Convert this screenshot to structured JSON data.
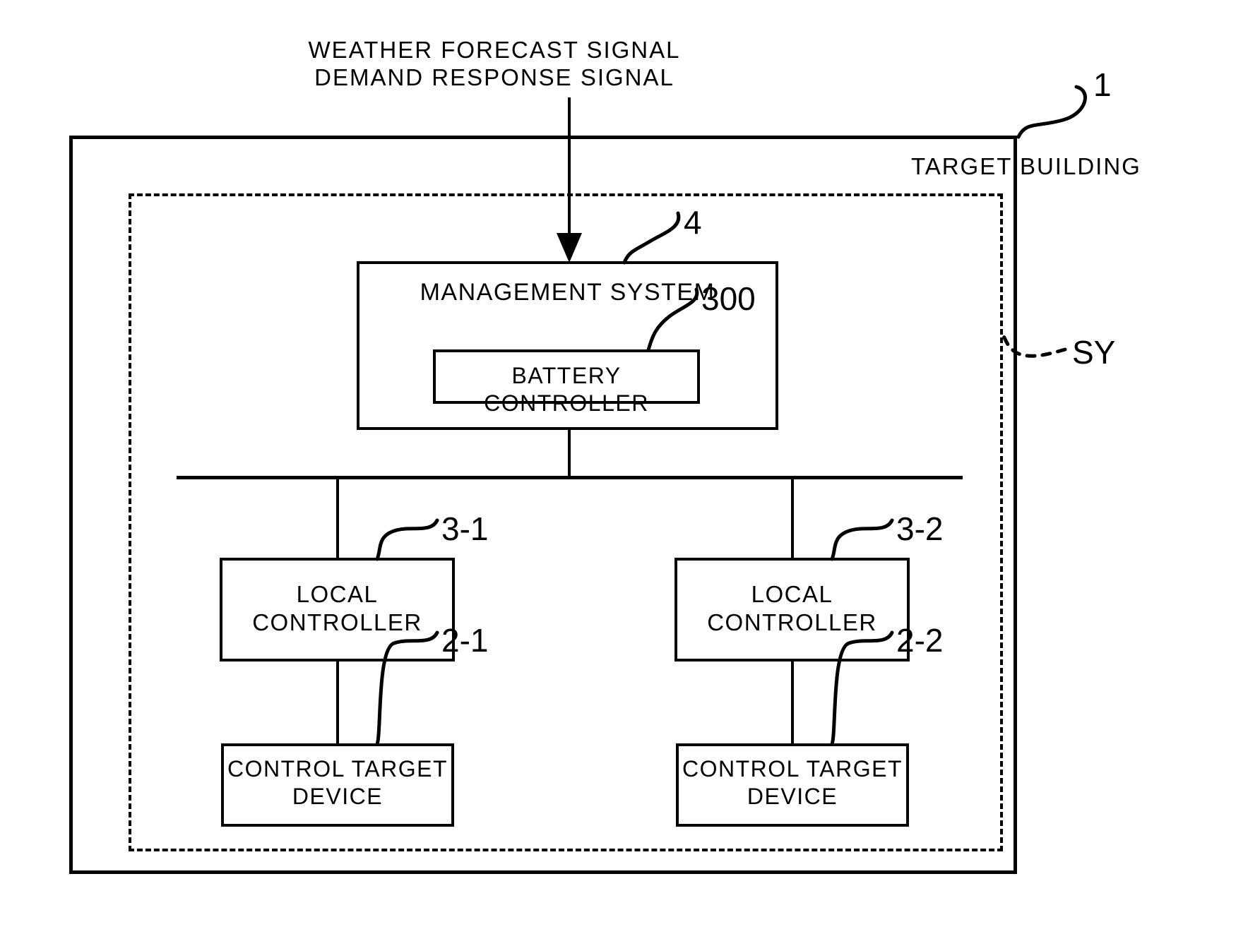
{
  "figure": {
    "signal_note": "WEATHER FORECAST SIGNAL\nDEMAND RESPONSE SIGNAL",
    "outer_ref": "1",
    "outer_label": "TARGET BUILDING",
    "system_ref": "SY"
  },
  "blocks": {
    "management_system": {
      "label": "MANAGEMENT SYSTEM",
      "ref": "4"
    },
    "battery_controller": {
      "label": "BATTERY CONTROLLER",
      "ref": "300"
    },
    "local_controller_1": {
      "label": "LOCAL\nCONTROLLER",
      "ref": "3-1"
    },
    "local_controller_2": {
      "label": "LOCAL\nCONTROLLER",
      "ref": "3-2"
    },
    "control_target_device_1": {
      "label": "CONTROL TARGET\nDEVICE",
      "ref": "2-1"
    },
    "control_target_device_2": {
      "label": "CONTROL TARGET\nDEVICE",
      "ref": "2-2"
    }
  },
  "colors": {
    "line": "#000000",
    "background": "#ffffff"
  }
}
